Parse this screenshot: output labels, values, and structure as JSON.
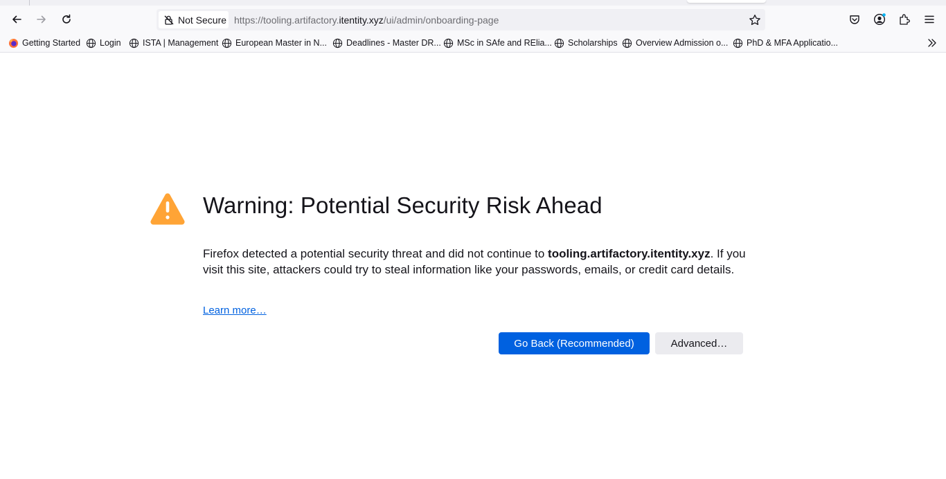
{
  "browser": {
    "security_label": "Not Secure",
    "url_prefix": "https://tooling.artifactory.",
    "url_domain": "itentity.xyz",
    "url_suffix": "/ui/admin/onboarding-page"
  },
  "bookmarks": [
    {
      "label": "Getting Started",
      "icon": "firefox-icon"
    },
    {
      "label": "Login",
      "icon": "globe-icon"
    },
    {
      "label": "ISTA | Management",
      "icon": "globe-icon"
    },
    {
      "label": "European Master in N...",
      "icon": "globe-icon"
    },
    {
      "label": "Deadlines - Master DR...",
      "icon": "globe-icon"
    },
    {
      "label": "MSc in SAfe and RElia...",
      "icon": "globe-icon"
    },
    {
      "label": "Scholarships",
      "icon": "globe-icon"
    },
    {
      "label": "Overview Admission o...",
      "icon": "globe-icon"
    },
    {
      "label": "PhD & MFA Applicatio...",
      "icon": "globe-icon"
    }
  ],
  "page": {
    "title": "Warning: Potential Security Risk Ahead",
    "desc_part1": "Firefox detected a potential security threat and did not continue to ",
    "desc_host": "tooling.artifactory.itentity.xyz",
    "desc_part2": ". If you visit this site, attackers could try to steal information like your passwords, emails, or credit card details.",
    "learn_more": "Learn more…",
    "go_back": "Go Back (Recommended)",
    "advanced": "Advanced…"
  },
  "colors": {
    "primary_button": "#0061e0",
    "warning_icon": "#ffa436",
    "link": "#0061e0"
  }
}
